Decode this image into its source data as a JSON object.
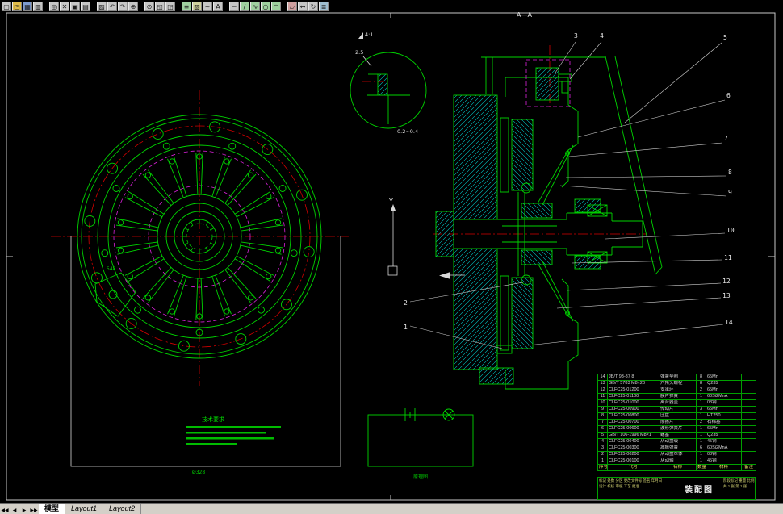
{
  "toolbar": {
    "icons": [
      {
        "n": "new",
        "g": "▢"
      },
      {
        "n": "open",
        "g": "◳",
        "c": "#e2bd4a"
      },
      {
        "n": "save",
        "g": "▦",
        "c": "#7e9cd0"
      },
      {
        "n": "print",
        "g": "▥"
      },
      {
        "n": "preview",
        "g": "◎",
        "gap": true
      },
      {
        "n": "cut",
        "g": "✕"
      },
      {
        "n": "copy",
        "g": "▣"
      },
      {
        "n": "paste",
        "g": "▤"
      },
      {
        "n": "match-props",
        "g": "▨",
        "gap": true
      },
      {
        "n": "undo",
        "g": "↶"
      },
      {
        "n": "redo",
        "g": "↷"
      },
      {
        "n": "pan",
        "g": "⊕"
      },
      {
        "n": "zoom-realtime",
        "g": "⊙",
        "gap": true
      },
      {
        "n": "zoom-window",
        "g": "◱"
      },
      {
        "n": "zoom-previous",
        "g": "◲"
      },
      {
        "n": "layers",
        "g": "≡",
        "c": "#9fd09f",
        "gap": true
      },
      {
        "n": "layer-color",
        "g": "▧",
        "c": "#d0d09f"
      },
      {
        "n": "linetype",
        "g": "~"
      },
      {
        "n": "text-style",
        "g": "A"
      },
      {
        "n": "dim-style",
        "g": "⊢",
        "gap": true
      },
      {
        "n": "draw-line",
        "g": "/",
        "c": "#9fd09f"
      },
      {
        "n": "draw-polyline",
        "g": "∿",
        "c": "#9fd09f"
      },
      {
        "n": "draw-circle",
        "g": "○",
        "c": "#9fd09f"
      },
      {
        "n": "draw-arc",
        "g": "◠",
        "c": "#9fd09f"
      },
      {
        "n": "erase",
        "g": "▱",
        "c": "#d09f9f",
        "gap": true
      },
      {
        "n": "move",
        "g": "↔"
      },
      {
        "n": "rotate",
        "g": "↻"
      },
      {
        "n": "properties",
        "g": "≣",
        "c": "#9fbfd0"
      }
    ]
  },
  "tabs": {
    "nav": [
      "◀◀",
      "◀",
      "▶",
      "▶▶"
    ],
    "items": [
      "模型",
      "Layout1",
      "Layout2"
    ],
    "active": "模型"
  },
  "drawing": {
    "labels": {
      "section": "A—A",
      "detail_scale": "4:1",
      "roughness": "2.5",
      "gap": "0.2~0.4",
      "dim_left": "548",
      "dim_bottom": "Ø328",
      "notes_title": "技术要求",
      "schematic_caption": "原理图",
      "ucs_y": "Y"
    },
    "balloons": [
      "1",
      "2",
      "3",
      "4",
      "5",
      "6",
      "7",
      "8",
      "9",
      "10",
      "11",
      "12",
      "13",
      "14"
    ],
    "colors": {
      "line": "#00d400",
      "hatch": "#00c8c8",
      "centerline": "#d40000",
      "hidden": "#dd22dd",
      "annotation": "#e0e0e0"
    }
  },
  "parts_table": {
    "columns": [
      "序号",
      "代号",
      "名称",
      "数量",
      "材料",
      "备注"
    ],
    "rows": [
      [
        "14",
        "JB/T 93-87 8",
        "弹簧垫圈",
        "8",
        "65Mn",
        ""
      ],
      [
        "13",
        "GB/T 5783 M8×20",
        "六角头螺栓",
        "8",
        "Q235",
        ""
      ],
      [
        "12",
        "CLFC25-01200",
        "支承环",
        "2",
        "65Mn",
        ""
      ],
      [
        "11",
        "CLFC25-01100",
        "膜片弹簧",
        "1",
        "60Si2MnA",
        ""
      ],
      [
        "10",
        "CLFC25-01000",
        "离合器盖",
        "1",
        "08钢",
        ""
      ],
      [
        "9",
        "CLFC25-00900",
        "传动片",
        "3",
        "65Mn",
        ""
      ],
      [
        "8",
        "CLFC25-00800",
        "压盘",
        "1",
        "HT250",
        ""
      ],
      [
        "7",
        "CLFC25-00700",
        "摩擦片",
        "2",
        "石棉基",
        ""
      ],
      [
        "6",
        "CLFC25-00600",
        "波形弹簧片",
        "1",
        "65Mn",
        ""
      ],
      [
        "5",
        "GB/T 106-1996 M8×1",
        "螺塞",
        "1",
        "Q235",
        ""
      ],
      [
        "4",
        "CLFC25-00400",
        "从动盘毂",
        "1",
        "45钢",
        ""
      ],
      [
        "3",
        "CLFC25-00300",
        "减振弹簧",
        "6",
        "60Si2MnA",
        ""
      ],
      [
        "2",
        "CLFC25-00200",
        "从动盘本体",
        "1",
        "08钢",
        ""
      ],
      [
        "1",
        "CLFC25-00100",
        "从动轴",
        "1",
        "45钢",
        ""
      ]
    ]
  },
  "title_block": {
    "title": "装配图",
    "row1": "标记 处数 分区 更改文件号 签名 年月日",
    "row2": "设计 校核 审核 工艺 批准",
    "right1": "阶段标记 重量 比例",
    "right2": "共 1 张 第 1 张"
  }
}
